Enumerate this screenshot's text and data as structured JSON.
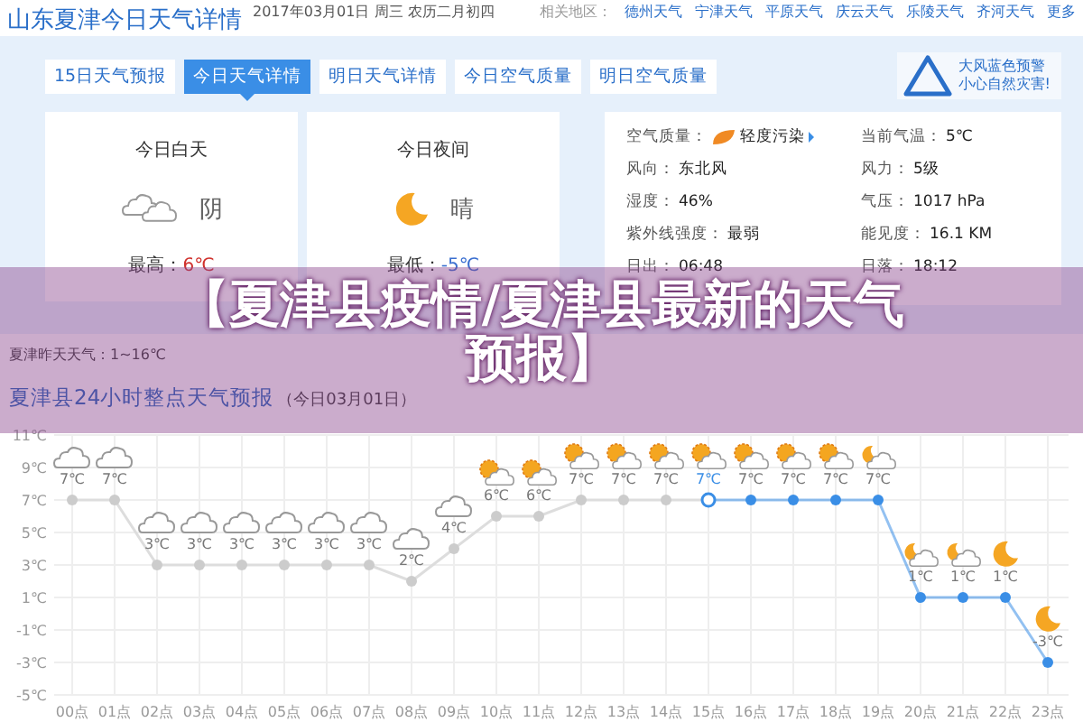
{
  "header": {
    "title": "山东夏津今日天气详情",
    "date": "2017年03月01日  周三  农历二月初四",
    "related_label": "相关地区：",
    "related": [
      "德州天气",
      "宁津天气",
      "平原天气",
      "庆云天气",
      "乐陵天气",
      "齐河天气",
      "更多"
    ]
  },
  "tabs": [
    {
      "label": "15日天气预报",
      "selected": false
    },
    {
      "label": "今日天气详情",
      "selected": true
    },
    {
      "label": "明日天气详情",
      "selected": false
    },
    {
      "label": "今日空气质量",
      "selected": false
    },
    {
      "label": "明日空气质量",
      "selected": false
    }
  ],
  "warning": {
    "lines": [
      "大风蓝色预警",
      "小心自然灾害!"
    ]
  },
  "periods": [
    {
      "kind": "day",
      "title": "今日白天",
      "condition": "阴",
      "temp_label": "最高：",
      "temp": "6℃"
    },
    {
      "kind": "night",
      "title": "今日夜间",
      "condition": "晴",
      "temp_label": "最低：",
      "temp": "-5℃"
    }
  ],
  "details": [
    {
      "label": "空气质量：",
      "value": "轻度污染",
      "kind": "air"
    },
    {
      "label": "当前气温：",
      "value": "5℃",
      "kind": "plain"
    },
    {
      "label": "风向：",
      "value": "东北风",
      "kind": "plain"
    },
    {
      "label": "风力：",
      "value": "5级",
      "kind": "plain"
    },
    {
      "label": "湿度：",
      "value": "46%",
      "kind": "plain"
    },
    {
      "label": "气压：",
      "value": "1017 hPa",
      "kind": "plain"
    },
    {
      "label": "紫外线强度：",
      "value": "最弱",
      "kind": "plain"
    },
    {
      "label": "能见度：",
      "value": "16.1 KM",
      "kind": "plain"
    },
    {
      "label": "日出：",
      "value": "06:48",
      "kind": "plain"
    },
    {
      "label": "日落：",
      "value": "18:12",
      "kind": "plain"
    }
  ],
  "yesterday": "夏津昨天天气：1~16℃",
  "forecast": {
    "title": "夏津县24小时整点天气预报",
    "date": "（今日03月01日）",
    "chart_data": {
      "type": "line",
      "categories": [
        "00点",
        "01点",
        "02点",
        "03点",
        "04点",
        "05点",
        "06点",
        "07点",
        "08点",
        "09点",
        "10点",
        "11点",
        "12点",
        "13点",
        "14点",
        "15点",
        "16点",
        "17点",
        "18点",
        "19点",
        "20点",
        "21点",
        "22点",
        "23点"
      ],
      "grid": true,
      "series": [
        {
          "color": "#3a8ee6",
          "marker": "circle",
          "values": [
            7,
            7,
            3,
            3,
            3,
            3,
            3,
            3,
            2,
            4,
            6,
            6,
            7,
            7,
            7,
            7,
            7,
            7,
            7,
            7,
            1,
            1,
            1,
            -3
          ]
        }
      ],
      "ylim": [
        -5,
        11
      ],
      "yticks": [
        {
          "value": 11,
          "label": "11℃"
        },
        {
          "value": 9,
          "label": "9℃"
        },
        {
          "value": 7,
          "label": "7℃"
        },
        {
          "value": 5,
          "label": "5℃"
        },
        {
          "value": 3,
          "label": "3℃"
        },
        {
          "value": 1,
          "label": "1℃"
        },
        {
          "value": -1,
          "label": "-1℃"
        },
        {
          "value": -3,
          "label": "-3℃"
        },
        {
          "value": -5,
          "label": "-5℃"
        }
      ],
      "value_labels": [
        "7℃",
        "7℃",
        "3℃",
        "3℃",
        "3℃",
        "3℃",
        "3℃",
        "3℃",
        "2℃",
        "4℃",
        "6℃",
        "6℃",
        "7℃",
        "7℃",
        "7℃",
        "7℃",
        "7℃",
        "7℃",
        "7℃",
        "7℃",
        "1℃",
        "1℃",
        "1℃",
        "-3℃"
      ]
    },
    "hours": [
      {
        "kind": "cloudy",
        "selected": false
      },
      {
        "kind": "cloudy",
        "selected": false
      },
      {
        "kind": "cloudy",
        "selected": false
      },
      {
        "kind": "cloudy",
        "selected": false
      },
      {
        "kind": "cloudy",
        "selected": false
      },
      {
        "kind": "cloudy",
        "selected": false
      },
      {
        "kind": "cloudy",
        "selected": false
      },
      {
        "kind": "cloudy",
        "selected": false
      },
      {
        "kind": "cloudy",
        "selected": false
      },
      {
        "kind": "cloudy",
        "selected": false
      },
      {
        "kind": "sun-cloud",
        "selected": false
      },
      {
        "kind": "sun-cloud",
        "selected": false
      },
      {
        "kind": "sun-cloud",
        "selected": false
      },
      {
        "kind": "sun-cloud",
        "selected": false
      },
      {
        "kind": "sun-cloud",
        "selected": false
      },
      {
        "kind": "sun-cloud",
        "selected": true
      },
      {
        "kind": "sun-cloud",
        "selected": false
      },
      {
        "kind": "sun-cloud",
        "selected": false
      },
      {
        "kind": "sun-cloud",
        "selected": false
      },
      {
        "kind": "moon-cloud",
        "selected": false
      },
      {
        "kind": "moon-cloud",
        "selected": false
      },
      {
        "kind": "moon-cloud",
        "selected": false
      },
      {
        "kind": "moon",
        "selected": false
      },
      {
        "kind": "moon",
        "selected": false
      }
    ]
  },
  "banner": {
    "text": "【夏津县疫情/夏津县最新的天气预报】"
  }
}
